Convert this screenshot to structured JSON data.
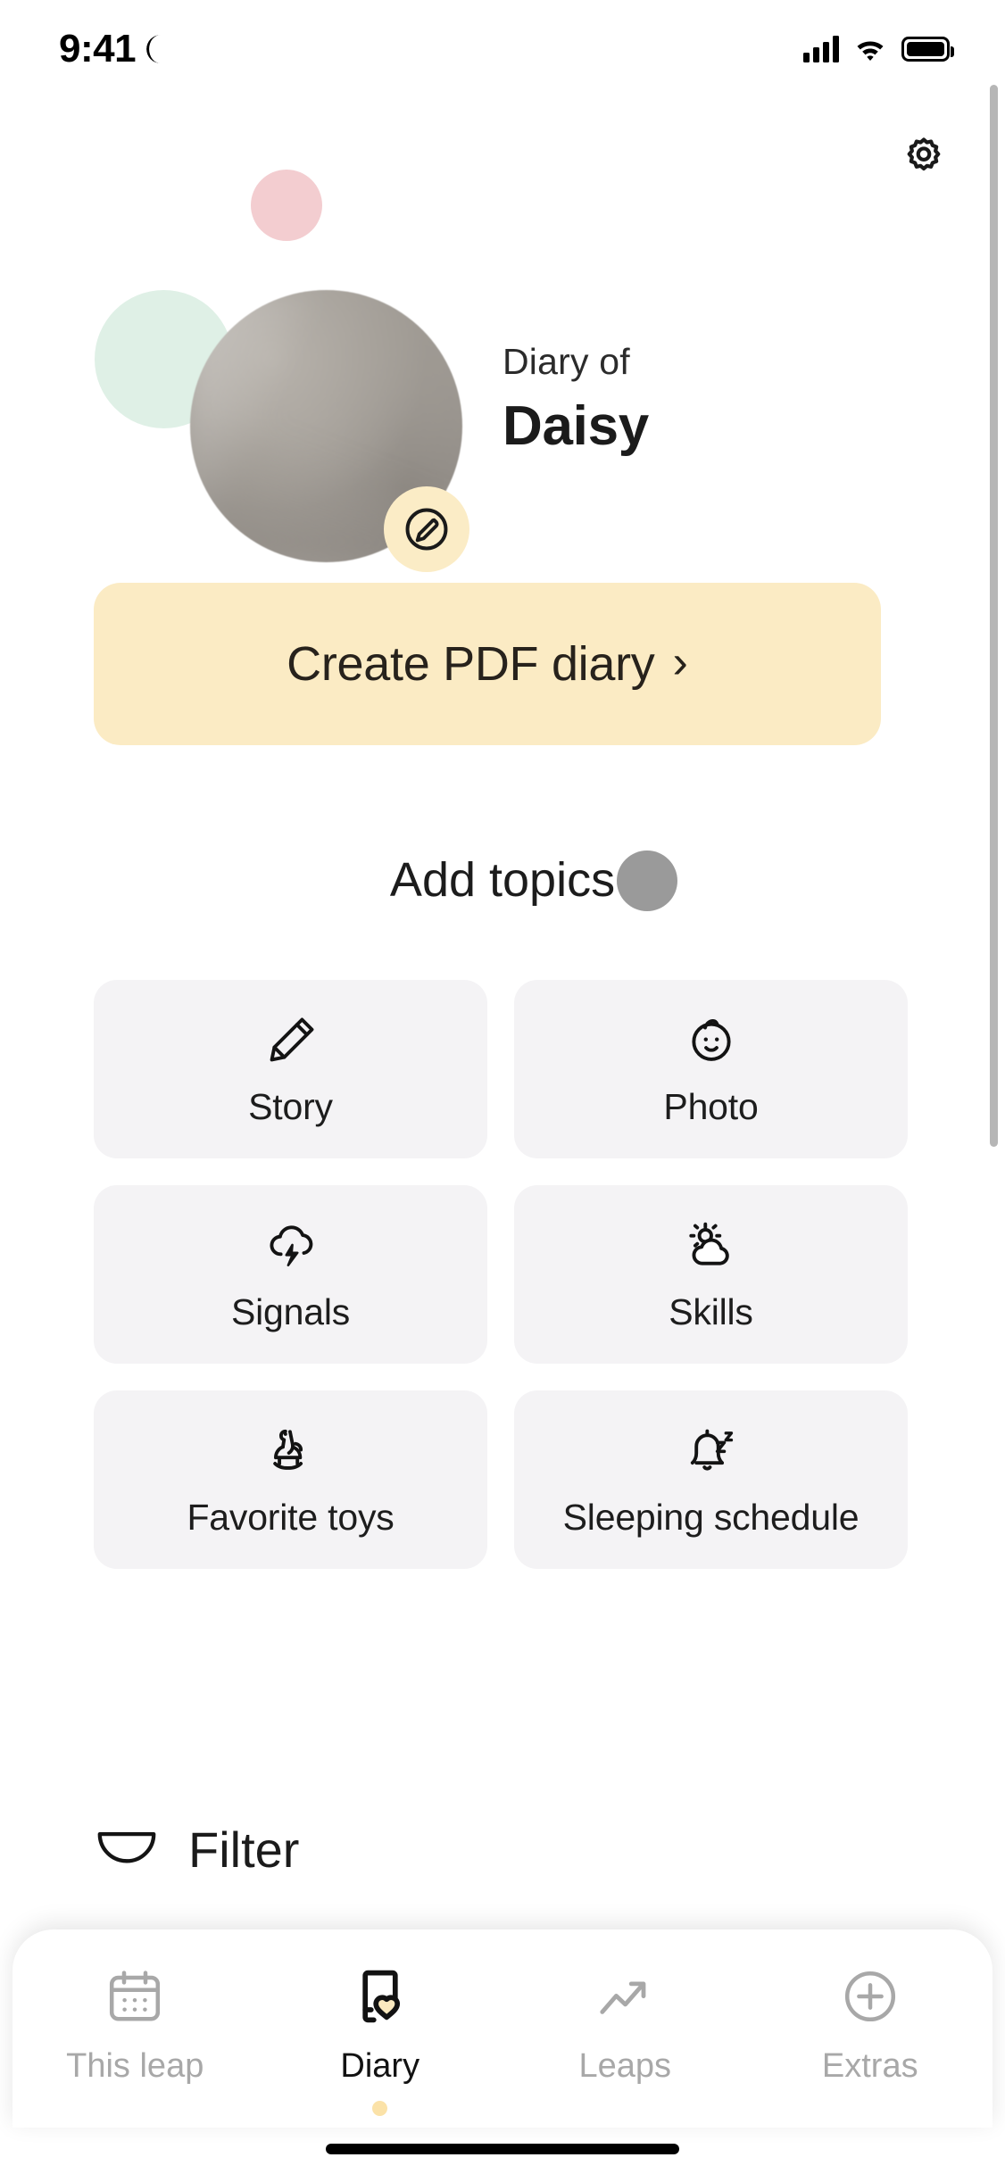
{
  "status_bar": {
    "time": "9:41",
    "dnd_icon": "moon-icon",
    "cellular_icon": "cellular-signal-icon",
    "wifi_icon": "wifi-icon",
    "battery_icon": "battery-full-icon"
  },
  "header": {
    "settings_icon": "gear-icon",
    "avatar_alt": "blurred-profile-photo",
    "edit_badge_icon": "pencil-circle-icon",
    "subtitle": "Diary of",
    "name": "Daisy"
  },
  "primary_action": {
    "label": "Create PDF diary",
    "chevron": "›",
    "background_color": "#fbebc4",
    "text_color": "#27221c"
  },
  "section": {
    "heading": "Add topics",
    "cursor_indicator": "touch-cursor-dot"
  },
  "topics": [
    {
      "label": "Story",
      "icon": "pencil-icon"
    },
    {
      "label": "Photo",
      "icon": "baby-face-icon"
    },
    {
      "label": "Signals",
      "icon": "storm-cloud-lightning-icon"
    },
    {
      "label": "Skills",
      "icon": "sun-behind-cloud-icon"
    },
    {
      "label": "Favorite toys",
      "icon": "rocking-horse-icon"
    },
    {
      "label": "Sleeping schedule",
      "icon": "sleeping-bell-icon"
    }
  ],
  "filter": {
    "label": "Filter",
    "icon": "funnel-icon"
  },
  "tabbar": {
    "items": [
      {
        "label": "This leap",
        "icon": "calendar-icon",
        "active": false
      },
      {
        "label": "Diary",
        "icon": "diary-heart-icon",
        "active": true
      },
      {
        "label": "Leaps",
        "icon": "trending-up-icon",
        "active": false
      },
      {
        "label": "Extras",
        "icon": "plus-circle-icon",
        "active": false
      }
    ],
    "active_dot_color": "#fbe2a8",
    "inactive_color": "#a8a8a8",
    "active_color": "#121212"
  },
  "decor": {
    "pink_circle_color": "#f3cdd0",
    "mint_circle_color": "#dff0e6"
  },
  "card_background": "#f4f3f5"
}
